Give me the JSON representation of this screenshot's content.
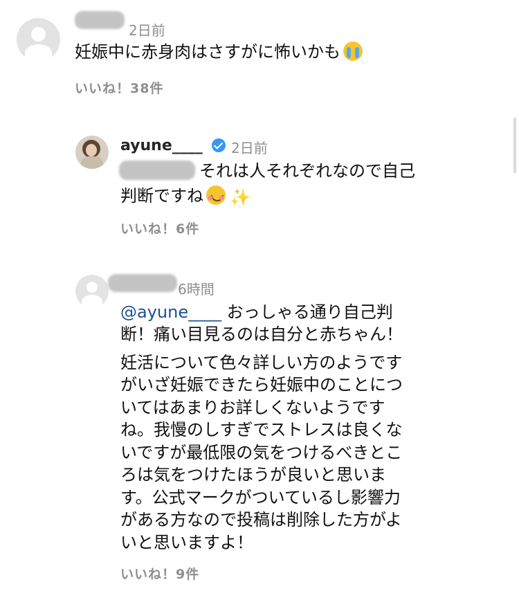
{
  "comments": [
    {
      "username_blurred": true,
      "time": "2日前",
      "text": "妊娠中に赤身肉はさすがに怖いかも",
      "emoji": "loudly-crying-face",
      "likes": "いいね！38件"
    },
    {
      "username": "ayune____",
      "verified": true,
      "time": "2日前",
      "text_line1": "それは人それぞれなので自己",
      "text_line2": "判断ですね",
      "emojis": [
        "smiling-face",
        "sparkles"
      ],
      "likes": "いいね！6件"
    },
    {
      "username_blurred": true,
      "time": "6時間",
      "mention": "@ayune____",
      "lines": [
        " おっしゃる通り自己判",
        "断！痛い目見るのは自分と赤ちゃん！",
        "妊活について色々詳しい方のようです",
        "がいざ妊娠できたら妊娠中のことにつ",
        "いてはあまりお詳しくないようです",
        "ね。我慢のしすぎでストレスは良くな",
        "いですが最低限の気をつけるべきとこ",
        "ろは気をつけたほうが良いと思いま",
        "す。公式マークがついているし影響力",
        "がある方なので投稿は削除した方がよ",
        "いと思いますよ！"
      ],
      "likes": "いいね！9件"
    }
  ],
  "colors": {
    "meta": "#8e8e8e",
    "mention": "#1d4f91",
    "verified": "#3897f0"
  }
}
